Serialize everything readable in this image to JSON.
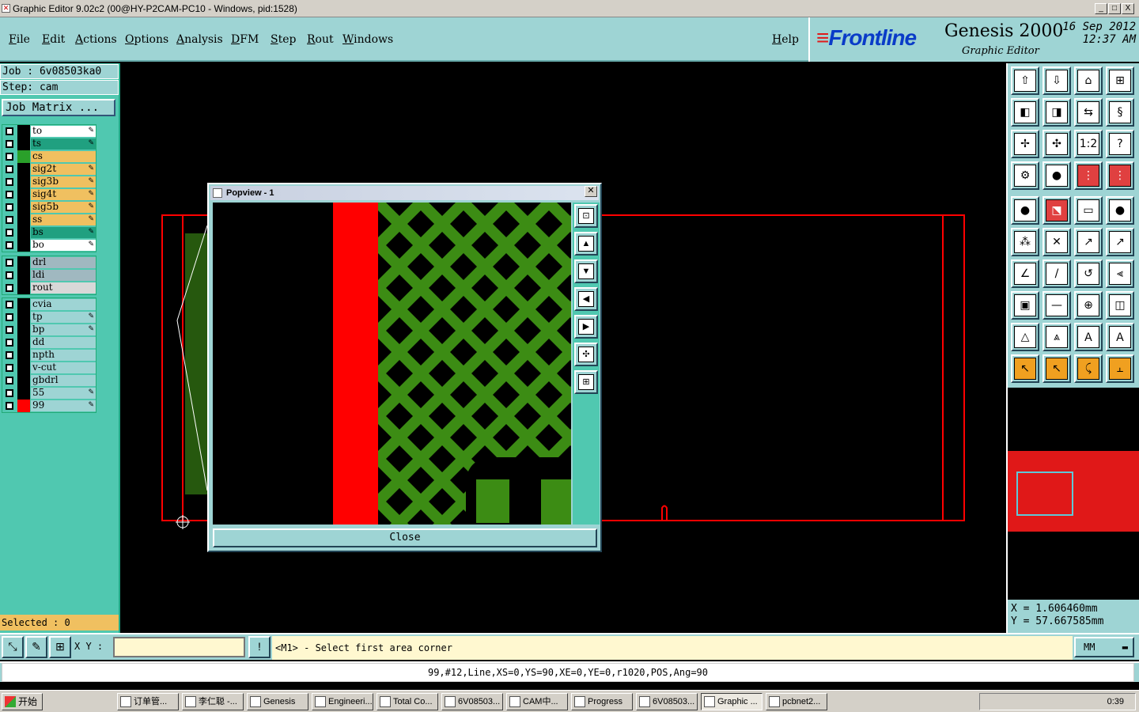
{
  "window": {
    "title": "Graphic Editor 9.02c2 (00@HY-P2CAM-PC10 - Windows, pid:1528)",
    "controls": [
      "_",
      "□",
      "X"
    ]
  },
  "menu": [
    "File",
    "Edit",
    "Actions",
    "Options",
    "Analysis",
    "DFM",
    "Step",
    "Rout",
    "Windows"
  ],
  "help_label": "Help",
  "brand": {
    "logo": "Frontline",
    "product": "Genesis 2000",
    "subtitle": "Graphic Editor",
    "date": "16 Sep 2012",
    "time": "12:37 AM"
  },
  "job": {
    "job_line": "Job : 6v08503ka0",
    "step_line": "Step: cam",
    "matrix_label": "Job Matrix ..."
  },
  "layer_groups": [
    [
      {
        "name": "to",
        "color": "#ffffff",
        "swatch": "#000000",
        "pen": true
      },
      {
        "name": "ts",
        "color": "#20a080",
        "swatch": "#000000",
        "pen": true
      },
      {
        "name": "cs",
        "color": "#f0c060",
        "swatch": "#2aa02a",
        "pen": false
      },
      {
        "name": "sig2t",
        "color": "#f0c060",
        "swatch": "#000000",
        "pen": true
      },
      {
        "name": "sig3b",
        "color": "#f0c060",
        "swatch": "#000000",
        "pen": true
      },
      {
        "name": "sig4t",
        "color": "#f0c060",
        "swatch": "#000000",
        "pen": true
      },
      {
        "name": "sig5b",
        "color": "#f0c060",
        "swatch": "#000000",
        "pen": true
      },
      {
        "name": "ss",
        "color": "#f0c060",
        "swatch": "#000000",
        "pen": true
      },
      {
        "name": "bs",
        "color": "#20a080",
        "swatch": "#000000",
        "pen": true
      },
      {
        "name": "bo",
        "color": "#ffffff",
        "swatch": "#000000",
        "pen": true
      }
    ],
    [
      {
        "name": "drl",
        "color": "#a0b8c0",
        "swatch": "#000000",
        "pen": false
      },
      {
        "name": "ldi",
        "color": "#a0b8c0",
        "swatch": "#000000",
        "pen": false
      },
      {
        "name": "rout",
        "color": "#d8d8d8",
        "swatch": "#000000",
        "pen": false
      }
    ],
    [
      {
        "name": "cvia",
        "color": "#9ed4d4",
        "swatch": "#000000",
        "pen": false
      },
      {
        "name": "tp",
        "color": "#9ed4d4",
        "swatch": "#000000",
        "pen": true
      },
      {
        "name": "bp",
        "color": "#9ed4d4",
        "swatch": "#000000",
        "pen": true
      },
      {
        "name": "dd",
        "color": "#9ed4d4",
        "swatch": "#000000",
        "pen": false
      },
      {
        "name": "npth",
        "color": "#9ed4d4",
        "swatch": "#000000",
        "pen": false
      },
      {
        "name": "v-cut",
        "color": "#9ed4d4",
        "swatch": "#000000",
        "pen": false
      },
      {
        "name": "gbdrl",
        "color": "#9ed4d4",
        "swatch": "#000000",
        "pen": false
      },
      {
        "name": "55",
        "color": "#9ed4d4",
        "swatch": "#000000",
        "pen": true
      },
      {
        "name": "99",
        "color": "#9ed4d4",
        "swatch": "#ff0000",
        "pen": true
      }
    ]
  ],
  "selected_label": "Selected : 0",
  "popview": {
    "title": "Popview - 1",
    "close_label": "Close"
  },
  "coords": {
    "x": "X  =  1.606460mm",
    "y": "Y  =  57.667585mm"
  },
  "bottom": {
    "xy_label": "X Y :",
    "xy_value": "",
    "prompt": "<M1> - Select first area corner",
    "unit": "MM",
    "status": "99,#12,Line,XS=0,YS=90,XE=0,YE=0,r1020,POS,Ang=90"
  },
  "taskbar": {
    "start": "开始",
    "tasks": [
      "订单管...",
      "李仁聪 -...",
      "Genesis",
      "Engineeri...",
      "Total Co...",
      "6V08503...",
      "CAM中...",
      "Progress",
      "6V08503...",
      "Graphic ...",
      "pcbnet2..."
    ],
    "clock": "0:39"
  },
  "colors": {
    "accent": "#9ed4d4",
    "panel": "#50c8b0",
    "outline": "#ff0000",
    "copper": "#3c8c14"
  }
}
